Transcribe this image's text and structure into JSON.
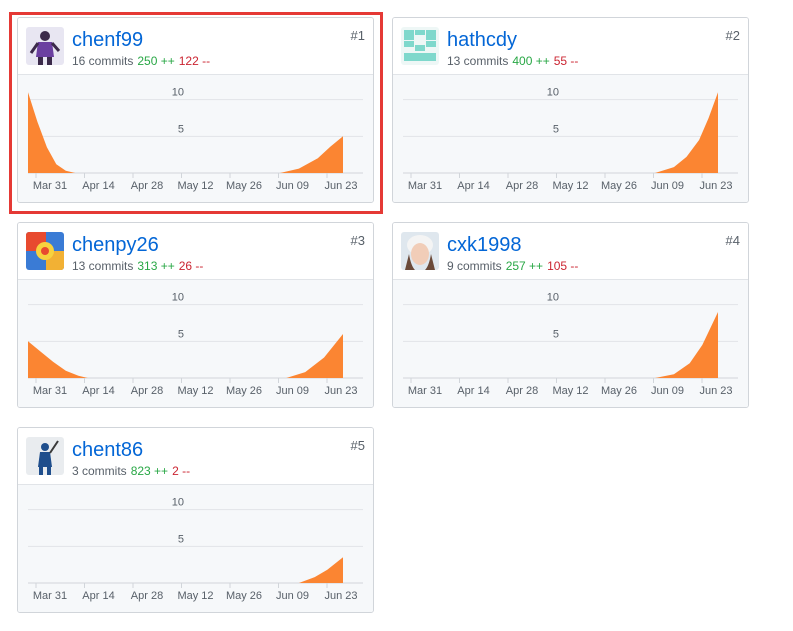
{
  "xticks": [
    "Mar 31",
    "Apr 14",
    "Apr 28",
    "May 12",
    "May 26",
    "Jun 09",
    "Jun 23"
  ],
  "yticks": [
    "10",
    "5"
  ],
  "colors": {
    "area": "#fb8532",
    "link": "#0366d6",
    "additions": "#28a745",
    "deletions": "#cb2431",
    "highlight": "#e53935"
  },
  "contributors": [
    {
      "rank": "#1",
      "name": "chenf99",
      "commits": "16 commits",
      "additions": "250 ++",
      "deletions": "122 --",
      "avatar_icon": "basketball-player-avatar-icon",
      "chart_data": {
        "type": "area",
        "ylim": [
          0,
          12
        ],
        "x": [
          0,
          0.03,
          0.06,
          0.09,
          0.12,
          0.15,
          0.8,
          0.86,
          0.92,
          0.96,
          1.0
        ],
        "y": [
          11,
          7,
          3.5,
          1.2,
          0.3,
          0,
          0,
          0.6,
          2.0,
          3.6,
          5
        ]
      }
    },
    {
      "rank": "#2",
      "name": "hathcdy",
      "commits": "13 commits",
      "additions": "400 ++",
      "deletions": "55 --",
      "avatar_icon": "pixel-identicon-avatar-icon",
      "chart_data": {
        "type": "area",
        "ylim": [
          0,
          12
        ],
        "x": [
          0,
          0.8,
          0.86,
          0.9,
          0.94,
          0.97,
          1.0
        ],
        "y": [
          0,
          0,
          0.8,
          2.2,
          4.5,
          7.5,
          11
        ]
      }
    },
    {
      "rank": "#3",
      "name": "chenpy26",
      "commits": "13 commits",
      "additions": "313 ++",
      "deletions": "26 --",
      "avatar_icon": "colorful-gift-avatar-icon",
      "chart_data": {
        "type": "area",
        "ylim": [
          0,
          12
        ],
        "x": [
          0,
          0.04,
          0.08,
          0.12,
          0.16,
          0.19,
          0.82,
          0.88,
          0.94,
          1.0
        ],
        "y": [
          5,
          3.6,
          2.2,
          1.0,
          0.3,
          0,
          0,
          0.8,
          2.8,
          6
        ]
      }
    },
    {
      "rank": "#4",
      "name": "cxk1998",
      "commits": "9 commits",
      "additions": "257 ++",
      "deletions": "105 --",
      "avatar_icon": "person-photo-avatar-icon",
      "chart_data": {
        "type": "area",
        "ylim": [
          0,
          12
        ],
        "x": [
          0,
          0.8,
          0.86,
          0.91,
          0.95,
          1.0
        ],
        "y": [
          0,
          0,
          0.5,
          2.0,
          4.5,
          9
        ]
      }
    },
    {
      "rank": "#5",
      "name": "chent86",
      "commits": "3 commits",
      "additions": "823 ++",
      "deletions": "2 --",
      "avatar_icon": "baseball-player-avatar-icon",
      "chart_data": {
        "type": "area",
        "ylim": [
          0,
          12
        ],
        "x": [
          0,
          0.86,
          0.91,
          0.95,
          1.0
        ],
        "y": [
          0,
          0,
          0.8,
          1.8,
          3.5
        ]
      }
    }
  ]
}
